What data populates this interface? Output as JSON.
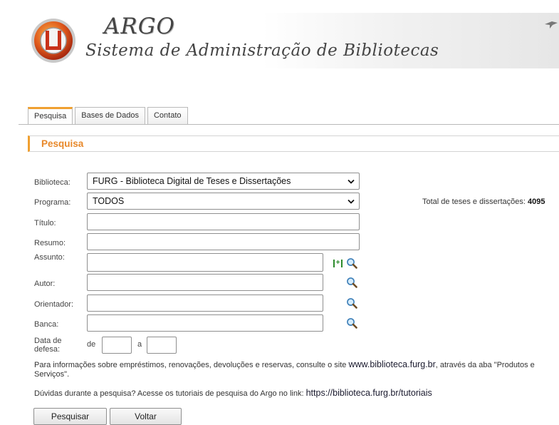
{
  "header": {
    "brand_title": "ARGO",
    "brand_subtitle": "Sistema de Administração de Bibliotecas"
  },
  "tabs": [
    {
      "label": "Pesquisa",
      "active": true
    },
    {
      "label": "Bases de Dados",
      "active": false
    },
    {
      "label": "Contato",
      "active": false
    }
  ],
  "section": {
    "title": "Pesquisa"
  },
  "form": {
    "biblioteca_label": "Biblioteca:",
    "biblioteca_value": "FURG - Biblioteca Digital de Teses e Dissertações",
    "programa_label": "Programa:",
    "programa_value": "TODOS",
    "titulo_label": "Título:",
    "resumo_label": "Resumo:",
    "assunto_label": "Assunto:",
    "autor_label": "Autor:",
    "orientador_label": "Orientador:",
    "banca_label": "Banca:",
    "data_label_line1": "Data de",
    "data_label_line2": "defesa:",
    "date_from_label": "de",
    "date_to_label": "a"
  },
  "total": {
    "label": "Total de teses e dissertações:",
    "value": "4095"
  },
  "info": {
    "line1_pre": "Para informações sobre empréstimos, renovações, devoluções e reservas, consulte o site",
    "line1_link": "www.biblioteca.furg.br",
    "line1_post": ", através da aba \"Produtos e",
    "line1_cont": "Serviços\".",
    "line2_pre": "Dúvidas durante a pesquisa? Acesse os tutoriais de pesquisa do Argo no link:",
    "line2_link": "https://biblioteca.furg.br/tutoriais"
  },
  "buttons": {
    "search_label": "Pesquisar",
    "back_label": "Voltar"
  },
  "colors": {
    "accent": "#f0a030",
    "section_title": "#e8882a",
    "add_icon": "#2b8a2b"
  },
  "icons": [
    "argo-logo-icon",
    "bird-icon",
    "magnifier-icon",
    "add-term-icon",
    "chevron-down-icon"
  ]
}
